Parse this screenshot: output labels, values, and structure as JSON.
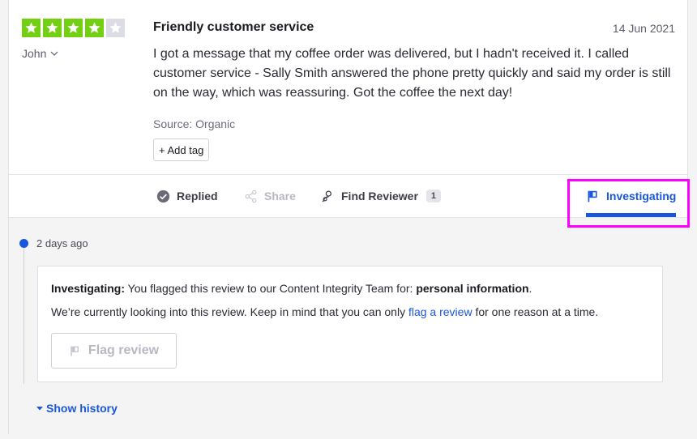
{
  "review": {
    "rating": 4,
    "max_rating": 5,
    "author": "John",
    "title": "Friendly customer service",
    "date": "14 Jun 2021",
    "body": "I got a message that my coffee order was delivered, but I hadn't received it. I called customer service - Sally Smith answered the phone pretty quickly and said my order is still on the way, which was reassuring. Got the coffee the next day!",
    "source": "Source: Organic",
    "add_tag": "+ Add tag"
  },
  "actions": {
    "replied": "Replied",
    "share": "Share",
    "find_reviewer": "Find Reviewer",
    "find_reviewer_count": "1",
    "investigating": "Investigating"
  },
  "timeline": {
    "time_ago": "2 days ago",
    "notice_label": "Investigating:",
    "notice_text": "You flagged this review to our Content Integrity Team for:",
    "notice_reason": "personal information",
    "notice_end": ".",
    "info_before": "We’re currently looking into this review. Keep in mind that you can only",
    "info_link": "flag a review",
    "info_after": "for one reason at a time.",
    "flag_button": "Flag review",
    "show_history": "Show history"
  },
  "colors": {
    "star_on": "#73cf11",
    "star_off": "#dcdce6",
    "accent": "#1a56db",
    "highlight": "#ff00ff"
  },
  "icons": {
    "star": "star-icon",
    "author_menu": "chevron-down-icon",
    "replied": "check-circle-icon",
    "share": "share-icon",
    "find_reviewer": "user-search-icon",
    "investigating": "flag-icon",
    "show_history": "caret-down-icon"
  }
}
